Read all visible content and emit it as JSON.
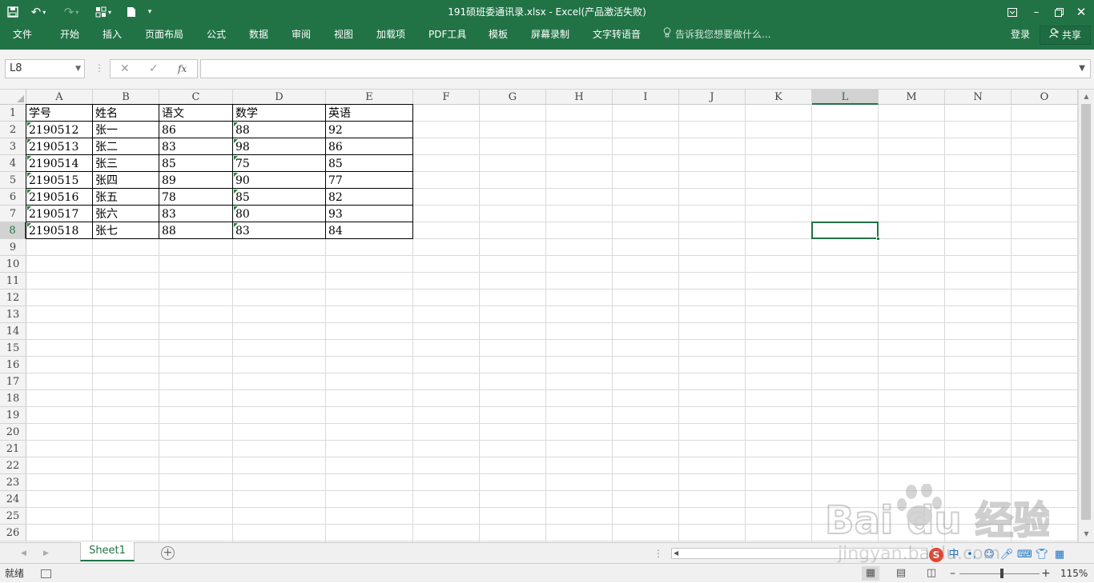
{
  "window": {
    "title": "191硕班委通讯录.xlsx  -  Excel(产品激活失败)"
  },
  "ribbon": {
    "tabs": [
      "文件",
      "开始",
      "插入",
      "页面布局",
      "公式",
      "数据",
      "审阅",
      "视图",
      "加载项",
      "PDF工具",
      "模板",
      "屏幕录制",
      "文字转语音"
    ],
    "tell_me": "告诉我您想要做什么...",
    "login": "登录",
    "share": "共享"
  },
  "formula_bar": {
    "name_box": "L8",
    "value": ""
  },
  "grid": {
    "columns": [
      "A",
      "B",
      "C",
      "D",
      "E",
      "F",
      "G",
      "H",
      "I",
      "J",
      "K",
      "L",
      "M",
      "N",
      "O"
    ],
    "rows": [
      "1",
      "2",
      "3",
      "4",
      "5",
      "6",
      "7",
      "8",
      "9",
      "10",
      "11",
      "12",
      "13",
      "14",
      "15",
      "16",
      "17",
      "18",
      "19",
      "20",
      "21",
      "22",
      "23",
      "24",
      "25",
      "26"
    ],
    "selected_cell": "L8",
    "selected_column": "L",
    "selected_row": "8",
    "data": [
      [
        "学号",
        "姓名",
        "语文",
        "数学",
        "英语"
      ],
      [
        "2190512",
        "张一",
        "86",
        "88",
        "92"
      ],
      [
        "2190513",
        "张二",
        "83",
        "98",
        "86"
      ],
      [
        "2190514",
        "张三",
        "85",
        "75",
        "85"
      ],
      [
        "2190515",
        "张四",
        "89",
        "90",
        "77"
      ],
      [
        "2190516",
        "张五",
        "78",
        "85",
        "82"
      ],
      [
        "2190517",
        "张六",
        "83",
        "80",
        "93"
      ],
      [
        "2190518",
        "张七",
        "88",
        "83",
        "84"
      ]
    ]
  },
  "sheets": {
    "active": "Sheet1"
  },
  "status": {
    "ready": "就绪",
    "zoom": "115%"
  },
  "watermark": {
    "brand": "Bai du 经验",
    "url": "jingyan.baidu.com"
  }
}
